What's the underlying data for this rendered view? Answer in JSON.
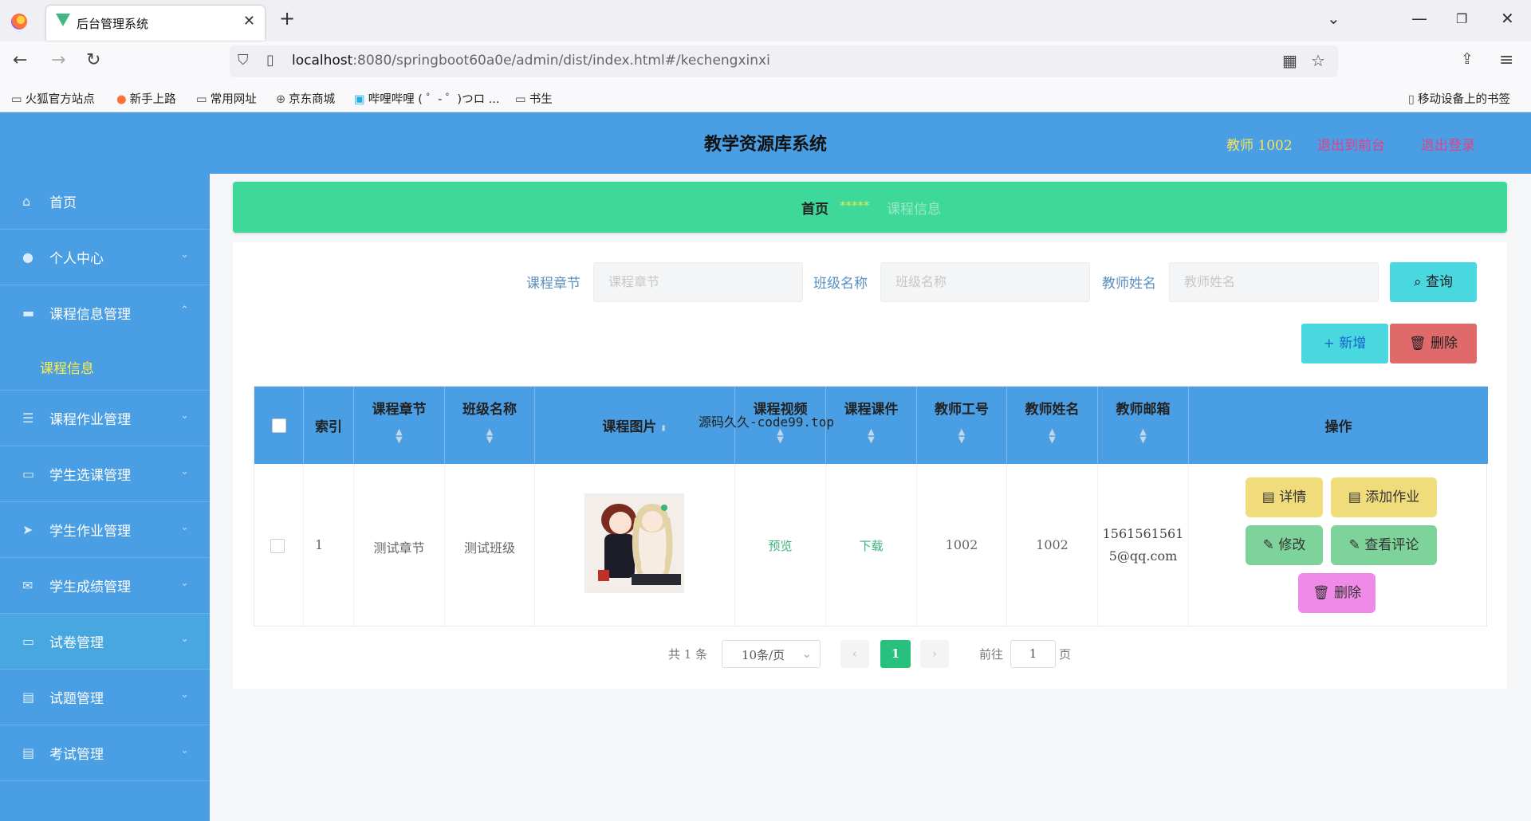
{
  "browser": {
    "tab_title": "后台管理系统",
    "url_host": "localhost",
    "url_rest": ":8080/springboot60a0e/admin/dist/index.html#/kechengxinxi",
    "bookmarks": [
      "火狐官方站点",
      "新手上路",
      "常用网址",
      "京东商城",
      "哔哩哔哩 ( ゜- ゜)つロ ...",
      "书生"
    ],
    "bookmarks_mobile": "移动设备上的书签"
  },
  "header": {
    "title": "教学资源库系统",
    "user": "教师 1002",
    "back_front": "退出到前台",
    "logout": "退出登录"
  },
  "sidebar": {
    "items": [
      {
        "label": "首页",
        "icon": "home-icon"
      },
      {
        "label": "个人中心",
        "icon": "user-icon"
      },
      {
        "label": "课程信息管理",
        "icon": "briefcase-icon"
      },
      {
        "label": "课程作业管理",
        "icon": "list-icon"
      },
      {
        "label": "学生选课管理",
        "icon": "monitor-icon"
      },
      {
        "label": "学生作业管理",
        "icon": "send-icon"
      },
      {
        "label": "学生成绩管理",
        "icon": "mail-icon"
      },
      {
        "label": "试卷管理",
        "icon": "monitor-icon"
      },
      {
        "label": "试题管理",
        "icon": "clipboard-icon"
      },
      {
        "label": "考试管理",
        "icon": "clipboard-icon"
      }
    ],
    "sub_item": "课程信息"
  },
  "breadcrumb": {
    "home": "首页",
    "separator": "*****",
    "current": "课程信息"
  },
  "search": {
    "chapter_label": "课程章节",
    "chapter_placeholder": "课程章节",
    "class_label": "班级名称",
    "class_placeholder": "班级名称",
    "teacher_label": "教师姓名",
    "teacher_placeholder": "教师姓名",
    "query_button": "查询",
    "add_button": "新增",
    "delete_button": "删除"
  },
  "table": {
    "headers": [
      "索引",
      "课程章节",
      "班级名称",
      "课程图片",
      "课程视频",
      "课程课件",
      "教师工号",
      "教师姓名",
      "教师邮箱",
      "操作"
    ],
    "rows": [
      {
        "index": "1",
        "chapter": "测试章节",
        "class_name": "测试班级",
        "video": "预览",
        "courseware": "下载",
        "teacher_id": "1002",
        "teacher_name": "1002",
        "email_line1": "1561561561",
        "email_line2": "5@qq.com"
      }
    ],
    "actions": {
      "detail": "详情",
      "add_homework": "添加作业",
      "edit": "修改",
      "view_comments": "查看评论",
      "delete": "删除"
    }
  },
  "pagination": {
    "total": "共 1 条",
    "page_size": "10条/页",
    "current_page": "1",
    "goto_label": "前往",
    "goto_value": "1",
    "page_suffix": "页"
  },
  "overlay_text": "源码久久-code99.top",
  "colors": {
    "primary": "#4a9fe4",
    "breadcrumb_bg": "#3ed99a",
    "query_btn": "#4ad8e0",
    "delete_btn": "#e06a6a",
    "detail_btn": "#f0dc7a",
    "edit_btn": "#7ed39a",
    "row_delete_btn": "#f08ae8"
  }
}
